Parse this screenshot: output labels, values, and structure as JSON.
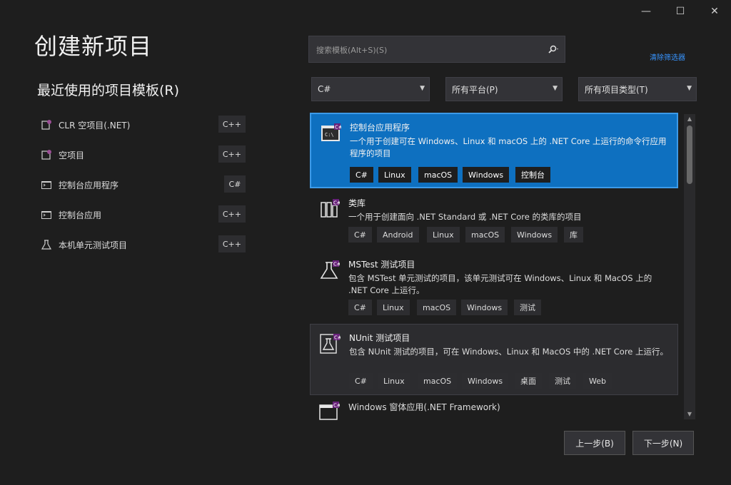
{
  "window": {
    "minimize": "—",
    "maximize": "☐",
    "close": "✕"
  },
  "title": "创建新项目",
  "recent": {
    "heading": "最近使用的项目模板(R)",
    "items": [
      {
        "label": "CLR 空项目(.NET)",
        "lang": "C++",
        "icon": "clr-empty-project-icon"
      },
      {
        "label": "空项目",
        "lang": "C++",
        "icon": "empty-project-icon"
      },
      {
        "label": "控制台应用程序",
        "lang": "C#",
        "icon": "console-app-icon"
      },
      {
        "label": "控制台应用",
        "lang": "C++",
        "icon": "console-app-icon"
      },
      {
        "label": "本机单元测试项目",
        "lang": "C++",
        "icon": "unit-test-icon"
      }
    ]
  },
  "search": {
    "placeholder": "搜索模板(Alt+S)(S)",
    "icon": "search-icon"
  },
  "clear_filter": "清除筛选器",
  "filters": {
    "language": "C#",
    "platform": "所有平台(P)",
    "project_type": "所有项目类型(T)"
  },
  "templates": [
    {
      "title": "控制台应用程序",
      "desc": "一个用于创建可在 Windows、Linux 和 macOS 上的 .NET Core 上运行的命令行应用程序的项目",
      "tags": [
        "C#",
        "Linux",
        "macOS",
        "Windows",
        "控制台"
      ],
      "icon": "console-app-icon",
      "state": "selected"
    },
    {
      "title": "类库",
      "desc": "一个用于创建面向 .NET Standard 或 .NET Core 的类库的项目",
      "tags": [
        "C#",
        "Android",
        "Linux",
        "macOS",
        "Windows",
        "库"
      ],
      "icon": "class-library-icon",
      "state": "normal"
    },
    {
      "title": "MSTest 测试项目",
      "desc": "包含 MSTest 单元测试的项目，该单元测试可在 Windows、Linux 和 MacOS 上的 .NET Core 上运行。",
      "tags": [
        "C#",
        "Linux",
        "macOS",
        "Windows",
        "测试"
      ],
      "icon": "mstest-project-icon",
      "state": "normal"
    },
    {
      "title": "NUnit 测试项目",
      "desc": "包含 NUnit 测试的项目，可在 Windows、Linux 和 MacOS 中的 .NET Core 上运行。",
      "tags": [
        "C#",
        "Linux",
        "macOS",
        "Windows",
        "桌面",
        "测试",
        "Web"
      ],
      "icon": "nunit-project-icon",
      "state": "hovered"
    },
    {
      "title": "Windows 窗体应用(.NET Framework)",
      "desc": "",
      "tags": [],
      "icon": "windows-forms-app-icon",
      "state": "normal"
    }
  ],
  "buttons": {
    "back": "上一步(B)",
    "next": "下一步(N)"
  },
  "colors": {
    "background": "#1e1e1e",
    "selected": "#0e70c0",
    "accent_link": "#3794ff"
  }
}
